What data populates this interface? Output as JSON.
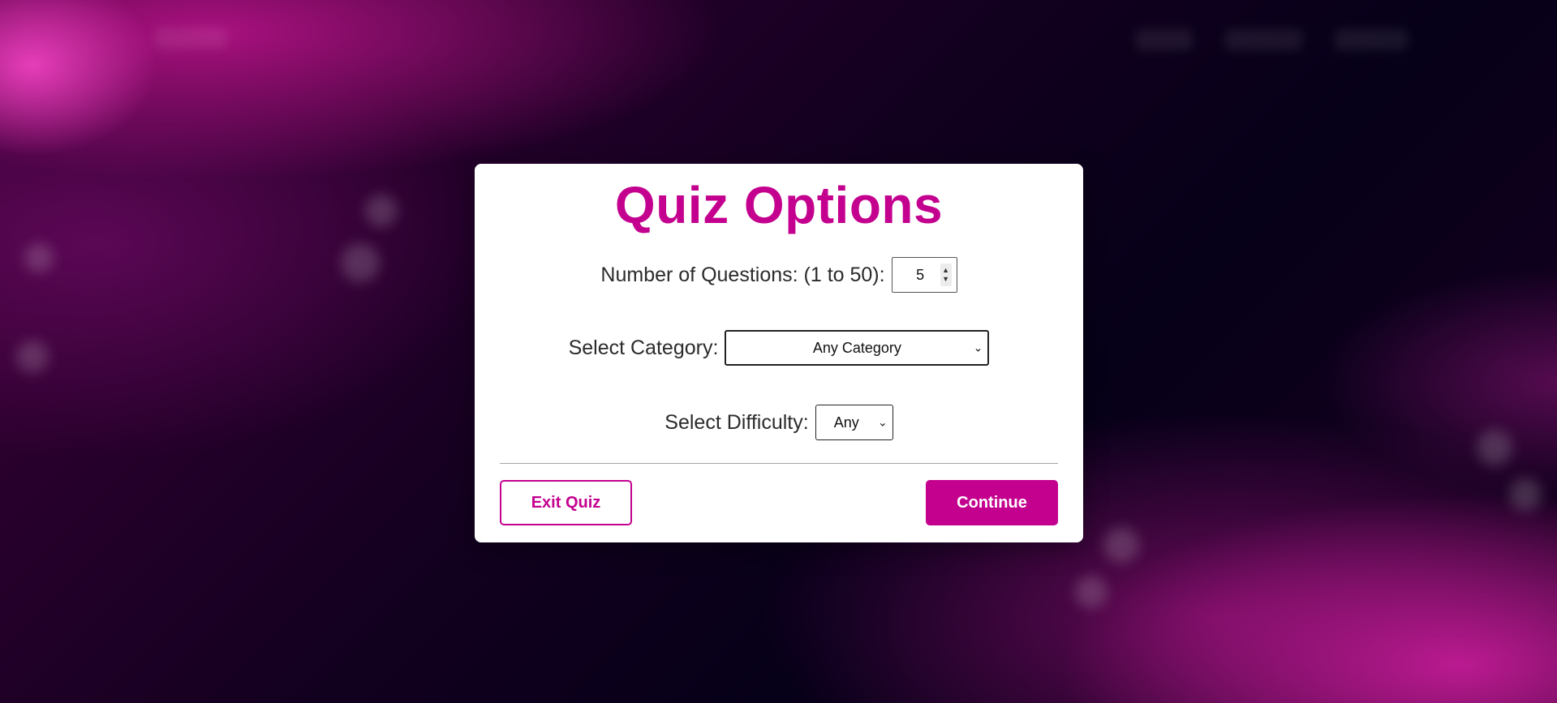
{
  "modal": {
    "title": "Quiz Options",
    "questions": {
      "label": "Number of Questions: (1 to 50):",
      "value": "5"
    },
    "category": {
      "label": "Select Category:",
      "selected": "Any Category"
    },
    "difficulty": {
      "label": "Select Difficulty:",
      "selected": "Any"
    },
    "buttons": {
      "exit_label": "Exit Quiz",
      "continue_label": "Continue"
    }
  },
  "icons": {
    "spinner_up": "▲",
    "spinner_down": "▼",
    "caret": "⌄"
  },
  "colors": {
    "accent": "#c4018f",
    "modal_bg": "#ffffff",
    "text": "#2b2b2b"
  }
}
